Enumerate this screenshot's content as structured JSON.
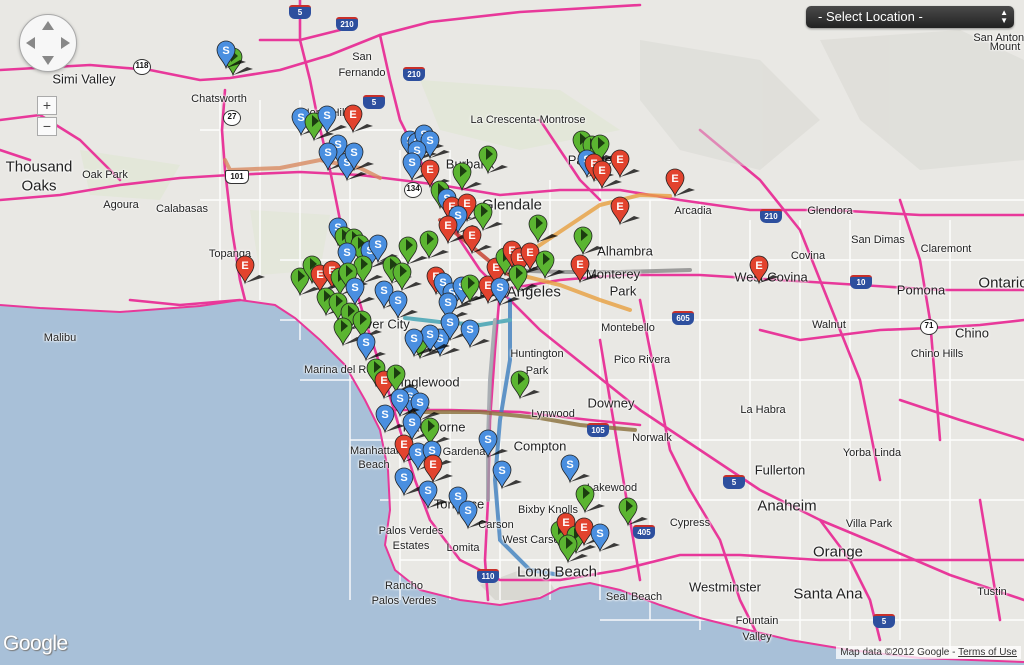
{
  "ui": {
    "select_location": "- Select Location -",
    "zoom_in": "+",
    "zoom_out": "−",
    "logo": "Google",
    "map_data": "Map data ©2012 Google",
    "separator": " - ",
    "terms": "Terms of Use"
  },
  "colors": {
    "water": "#a8c0d8",
    "land": "#e9e8e4",
    "highway": "#e8389a",
    "marker_green": "#5bb531",
    "marker_blue": "#4a8fe0",
    "marker_red": "#e2432e"
  },
  "marker_legend_letters": {
    "blue": "S",
    "red": "E"
  },
  "places": [
    {
      "name": "Simi Valley",
      "size": "normal"
    },
    {
      "name": "Chatsworth",
      "size": "small"
    },
    {
      "name": "San",
      "size": "small"
    },
    {
      "name": "Fernando",
      "size": "small"
    },
    {
      "name": "North Hills",
      "size": "small"
    },
    {
      "name": "Burbank",
      "size": "normal"
    },
    {
      "name": "La Crescenta-Montrose",
      "size": "small"
    },
    {
      "name": "Pasadena",
      "size": "normal"
    },
    {
      "name": "Glendale",
      "size": "big"
    },
    {
      "name": "Arcadia",
      "size": "small"
    },
    {
      "name": "Glendora",
      "size": "small"
    },
    {
      "name": "Thousand",
      "size": "big"
    },
    {
      "name": "Oaks",
      "size": "big"
    },
    {
      "name": "Oak Park",
      "size": "small"
    },
    {
      "name": "Agoura",
      "size": "small"
    },
    {
      "name": "Calabasas",
      "size": "small"
    },
    {
      "name": "Topanga",
      "size": "small"
    },
    {
      "name": "Malibu",
      "size": "small"
    },
    {
      "name": "Alhambra",
      "size": "normal"
    },
    {
      "name": "Monterey",
      "size": "normal"
    },
    {
      "name": "Park",
      "size": "normal"
    },
    {
      "name": "Los Angeles",
      "size": "big"
    },
    {
      "name": "Covina",
      "size": "small"
    },
    {
      "name": "West Covina",
      "size": "normal"
    },
    {
      "name": "San Dimas",
      "size": "small"
    },
    {
      "name": "Claremont",
      "size": "small"
    },
    {
      "name": "Pomona",
      "size": "normal"
    },
    {
      "name": "Ontario",
      "size": "big"
    },
    {
      "name": "Walnut",
      "size": "small"
    },
    {
      "name": "Chino",
      "size": "normal"
    },
    {
      "name": "Chino Hills",
      "size": "small"
    },
    {
      "name": "Montebello",
      "size": "small"
    },
    {
      "name": "Culver City",
      "size": "normal"
    },
    {
      "name": "Huntington",
      "size": "small"
    },
    {
      "name": "Park",
      "size": "small"
    },
    {
      "name": "Pico Rivera",
      "size": "small"
    },
    {
      "name": "Marina del Rey",
      "size": "small"
    },
    {
      "name": "Inglewood",
      "size": "normal"
    },
    {
      "name": "Lynwood",
      "size": "small"
    },
    {
      "name": "Downey",
      "size": "normal"
    },
    {
      "name": "La Habra",
      "size": "small"
    },
    {
      "name": "Norwalk",
      "size": "small"
    },
    {
      "name": "Compton",
      "size": "normal"
    },
    {
      "name": "Hawthorne",
      "size": "normal"
    },
    {
      "name": "Gardena",
      "size": "small"
    },
    {
      "name": "Manhattan",
      "size": "small"
    },
    {
      "name": "Beach",
      "size": "small"
    },
    {
      "name": "Fullerton",
      "size": "normal"
    },
    {
      "name": "Yorba Linda",
      "size": "small"
    },
    {
      "name": "Lakewood",
      "size": "small"
    },
    {
      "name": "Anaheim",
      "size": "big"
    },
    {
      "name": "Villa Park",
      "size": "small"
    },
    {
      "name": "Bixby Knolls",
      "size": "small"
    },
    {
      "name": "Cypress",
      "size": "small"
    },
    {
      "name": "Palos Verdes",
      "size": "small"
    },
    {
      "name": "Estates",
      "size": "small"
    },
    {
      "name": "Torrance",
      "size": "normal"
    },
    {
      "name": "Carson",
      "size": "small"
    },
    {
      "name": "Lomita",
      "size": "small"
    },
    {
      "name": "West Carson",
      "size": "small"
    },
    {
      "name": "Orange",
      "size": "big"
    },
    {
      "name": "Long Beach",
      "size": "big"
    },
    {
      "name": "Rancho",
      "size": "small"
    },
    {
      "name": "Palos Verdes",
      "size": "small"
    },
    {
      "name": "Westminster",
      "size": "normal"
    },
    {
      "name": "Santa Ana",
      "size": "big"
    },
    {
      "name": "Seal Beach",
      "size": "small"
    },
    {
      "name": "Fountain",
      "size": "small"
    },
    {
      "name": "Valley",
      "size": "small"
    },
    {
      "name": "San Antonio",
      "size": "small"
    },
    {
      "name": "Mount",
      "size": "small"
    },
    {
      "name": "Tustin",
      "size": "small"
    }
  ],
  "shields": [
    {
      "label": "5",
      "type": "i"
    },
    {
      "label": "210",
      "type": "i"
    },
    {
      "label": "118",
      "type": "st"
    },
    {
      "label": "210",
      "type": "i"
    },
    {
      "label": "5",
      "type": "i"
    },
    {
      "label": "27",
      "type": "st"
    },
    {
      "label": "101",
      "type": "us"
    },
    {
      "label": "134",
      "type": "st"
    },
    {
      "label": "210",
      "type": "i"
    },
    {
      "label": "10",
      "type": "i"
    },
    {
      "label": "71",
      "type": "st"
    },
    {
      "label": "605",
      "type": "i"
    },
    {
      "label": "105",
      "type": "i"
    },
    {
      "label": "5",
      "type": "i"
    },
    {
      "label": "405",
      "type": "i"
    },
    {
      "label": "110",
      "type": "i"
    },
    {
      "label": "5",
      "type": "i"
    }
  ]
}
